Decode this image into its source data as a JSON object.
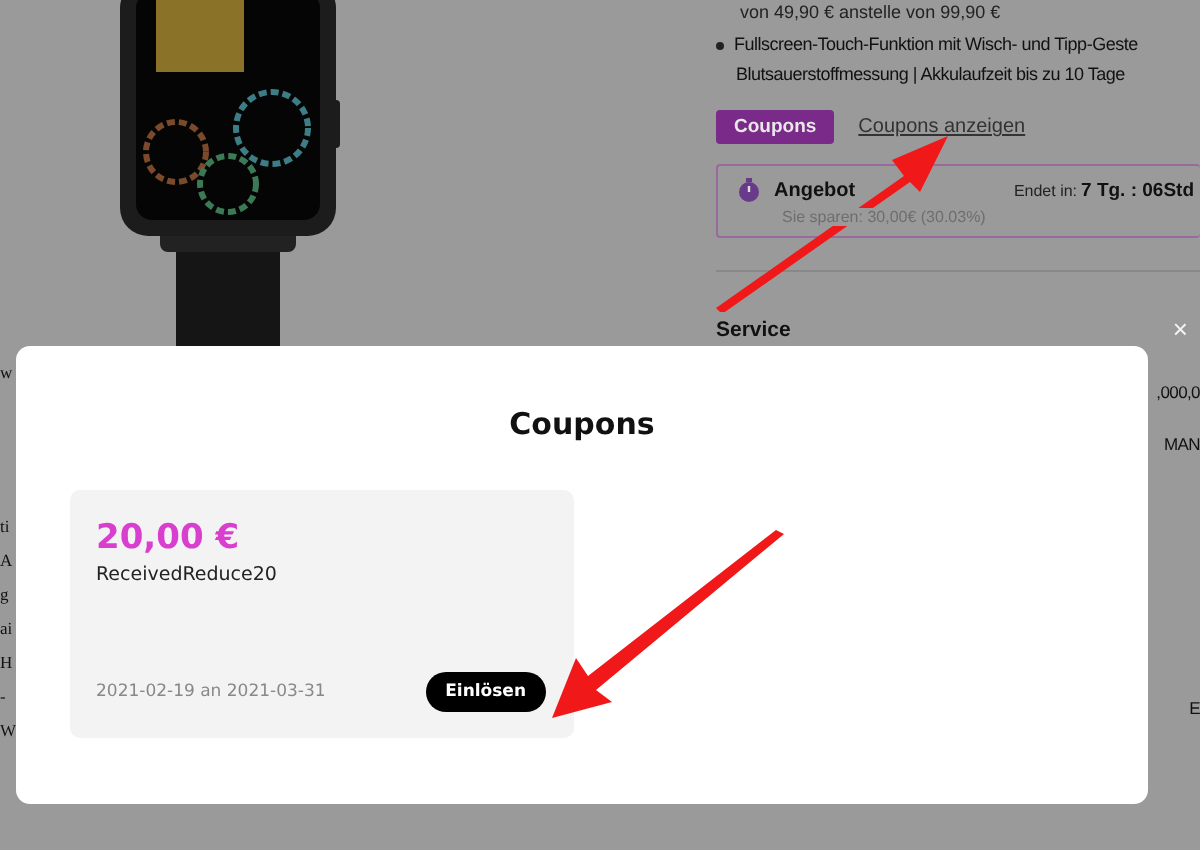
{
  "product": {
    "price_line": "von 49,90 € anstelle von 99,90 €",
    "features": [
      "Fullscreen-Touch-Funktion mit Wisch- und Tipp-Geste",
      "Blutsauerstoffmessung | Akkulaufzeit bis zu 10 Tage"
    ],
    "coupon_badge": "Coupons",
    "coupon_link": "Coupons anzeigen",
    "offer": {
      "title": "Angebot",
      "ends_label": "Endet in:",
      "ends_value": "7 Tg. : 06Std",
      "savings": "Sie sparen: 30,00€ (30.03%)"
    },
    "service_heading": "Service"
  },
  "left_fragments": [
    [
      "w"
    ],
    [
      "ti",
      "A",
      "g",
      "ai",
      "H",
      "-",
      "W"
    ]
  ],
  "right_fragments": [
    ",000,0",
    "MAN",
    "E"
  ],
  "modal": {
    "title": "Coupons",
    "close": "×",
    "coupons": [
      {
        "amount": "20,00 €",
        "code": "ReceivedReduce20",
        "validity": "2021-02-19 an 2021-03-31",
        "button": "Einlösen"
      }
    ]
  }
}
